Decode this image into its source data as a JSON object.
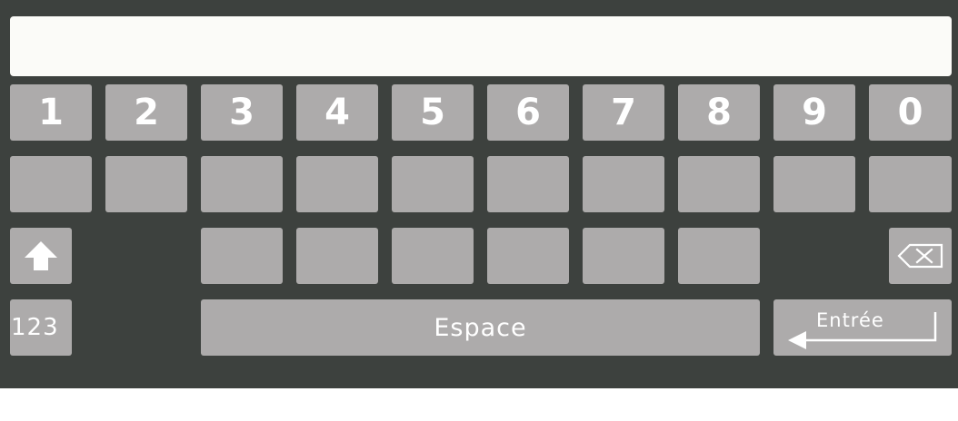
{
  "text_field": {
    "value": "",
    "placeholder": ""
  },
  "number_row": [
    "1",
    "2",
    "3",
    "4",
    "5",
    "6",
    "7",
    "8",
    "9",
    "0"
  ],
  "letter_row_1": [
    "",
    "",
    "",
    "",
    "",
    "",
    "",
    "",
    "",
    ""
  ],
  "letter_row_2": [
    "",
    "",
    "",
    "",
    "",
    ""
  ],
  "bottom_row": {
    "mode_key": "123",
    "space_key": "Espace",
    "enter_key": "Entrée"
  },
  "icons": {
    "shift": "shift-arrow-up-icon",
    "backspace": "backspace-icon",
    "enter": "enter-return-arrow-icon"
  },
  "colors": {
    "keyboard_background": "#3d413e",
    "key": "#adabab",
    "key_label": "#ffffff",
    "text_field": "#fbfbf8"
  }
}
